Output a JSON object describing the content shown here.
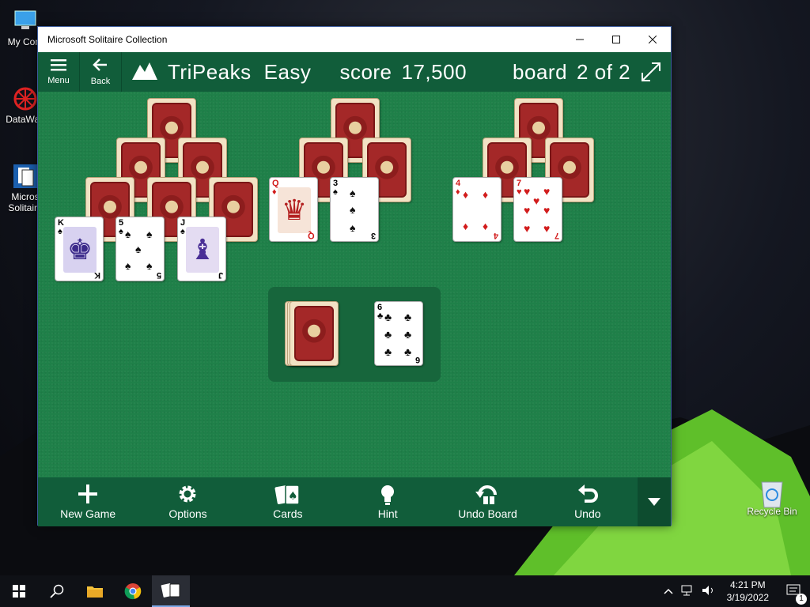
{
  "desktop": {
    "icons": [
      {
        "label": "My Com",
        "icon": "computer-icon"
      },
      {
        "label": "DataWag",
        "icon": "datawag-icon"
      },
      {
        "label": "Micros Solitaire",
        "icon": "solitaire-icon"
      }
    ],
    "recycle_bin": "Recycle Bin"
  },
  "window": {
    "title": "Microsoft Solitaire Collection",
    "controls": [
      "minimize",
      "maximize",
      "close"
    ]
  },
  "header": {
    "menu_label": "Menu",
    "back_label": "Back",
    "game": "TriPeaks",
    "difficulty": "Easy",
    "score_label": "score",
    "score_value": "17,500",
    "board_label": "board",
    "board_value": "2 of 2"
  },
  "tableau": {
    "face_up": [
      {
        "rank": "K",
        "suit": "♠",
        "color": "blk",
        "court": true
      },
      {
        "rank": "5",
        "suit": "♠",
        "color": "blk",
        "court": false
      },
      {
        "rank": "J",
        "suit": "♠",
        "color": "blk",
        "court": true
      },
      {
        "rank": "Q",
        "suit": "♦",
        "color": "red",
        "court": true
      },
      {
        "rank": "3",
        "suit": "♠",
        "color": "blk",
        "court": false
      },
      {
        "rank": "4",
        "suit": "♦",
        "color": "red",
        "court": false
      },
      {
        "rank": "7",
        "suit": "♥",
        "color": "red",
        "court": false
      }
    ],
    "waste_card": {
      "rank": "6",
      "suit": "♣",
      "color": "blk"
    }
  },
  "toolbar": {
    "new_game": "New Game",
    "options": "Options",
    "cards": "Cards",
    "hint": "Hint",
    "undo_board": "Undo Board",
    "undo": "Undo"
  },
  "taskbar": {
    "time": "4:21 PM",
    "date": "3/19/2022",
    "notifications": "1"
  }
}
